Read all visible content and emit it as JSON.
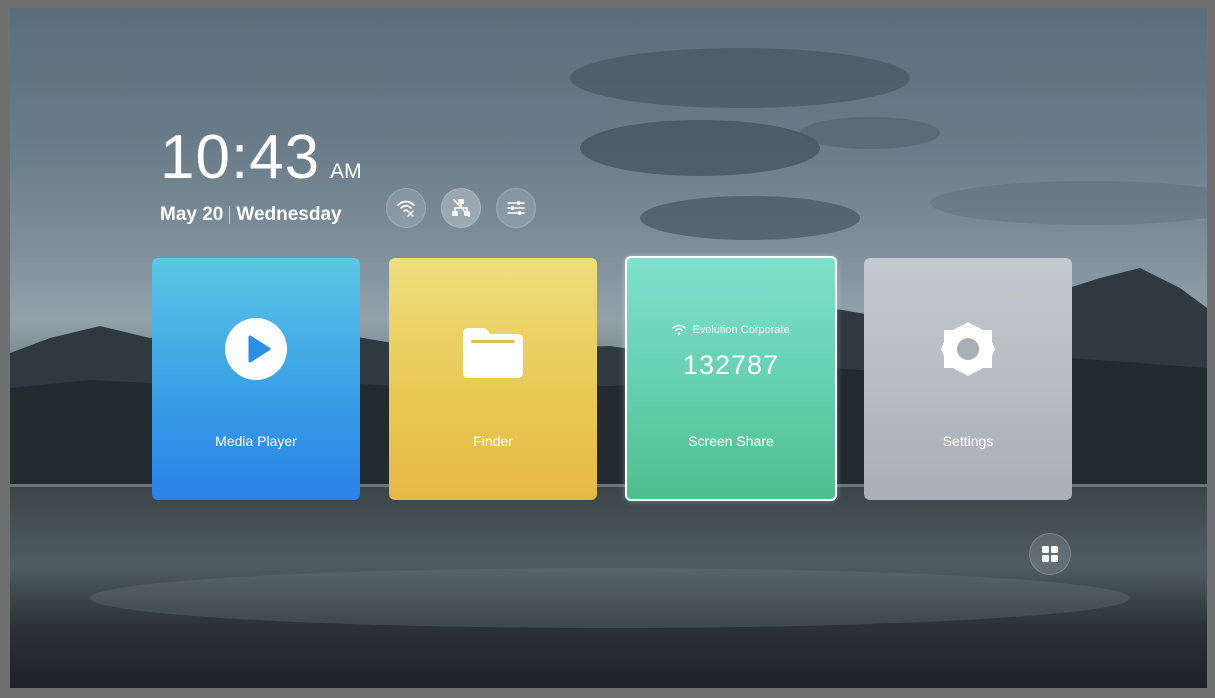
{
  "clock": {
    "time": "10:43",
    "ampm": "AM",
    "date": "May 20",
    "weekday": "Wednesday"
  },
  "status_icons": [
    {
      "icon": "wifi-off-icon"
    },
    {
      "icon": "network-disconnected-icon"
    },
    {
      "icon": "sliders-icon"
    }
  ],
  "tiles": {
    "media_player": {
      "label": "Media Player",
      "icon": "play-icon",
      "color": "#3aa0e6"
    },
    "finder": {
      "label": "Finder",
      "icon": "folder-icon",
      "color": "#e9c955"
    },
    "screen_share": {
      "label": "Screen Share",
      "network_name": "Evolution Corporate",
      "code": "132787",
      "icon": "wifi-icon",
      "color": "#64cfae"
    },
    "settings": {
      "label": "Settings",
      "icon": "gear-icon",
      "color": "#b5bbc1"
    }
  },
  "apps_button": {
    "icon": "grid-icon"
  }
}
